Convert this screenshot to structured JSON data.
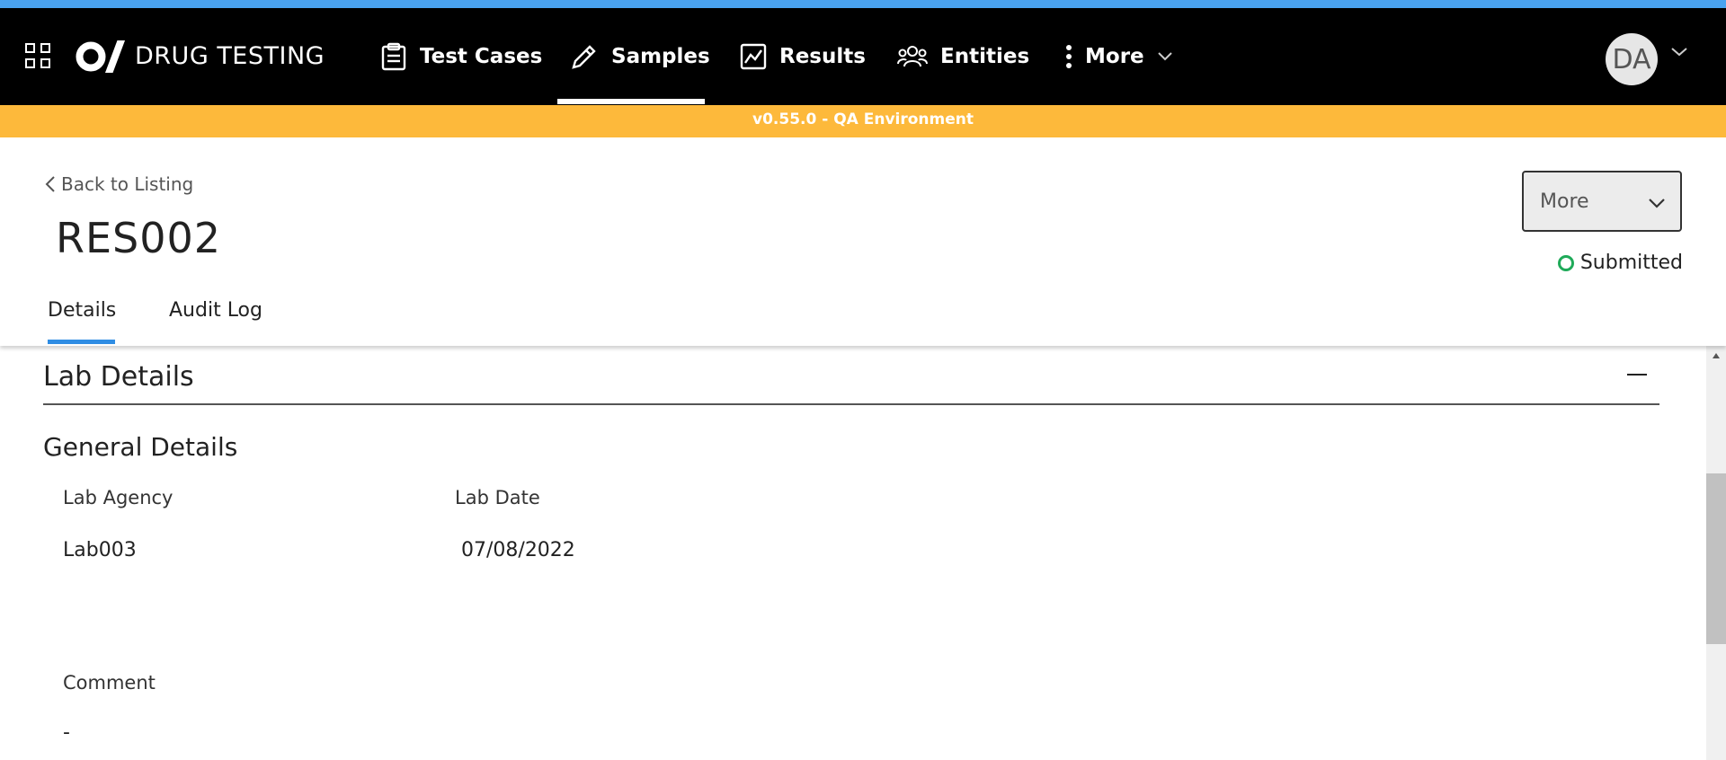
{
  "app": {
    "brand": "DRUG TESTING"
  },
  "nav": {
    "items": [
      {
        "label": "Test Cases",
        "icon": "clipboard-icon"
      },
      {
        "label": "Samples",
        "icon": "pen-icon",
        "active": true
      },
      {
        "label": "Results",
        "icon": "chart-icon"
      },
      {
        "label": "Entities",
        "icon": "people-icon"
      },
      {
        "label": "More",
        "icon": "kebab-icon"
      }
    ]
  },
  "user": {
    "initials": "DA"
  },
  "env": {
    "banner": "v0.55.0 - QA Environment"
  },
  "header": {
    "back_label": "Back to Listing",
    "title": "RES002",
    "tabs": [
      {
        "label": "Details",
        "active": true
      },
      {
        "label": "Audit Log"
      }
    ],
    "more_label": "More",
    "status": "Submitted"
  },
  "section": {
    "title": "Lab Details",
    "subtitle": "General Details",
    "fields": [
      {
        "label": "Lab Agency",
        "value": "Lab003"
      },
      {
        "label": "Lab Date",
        "value": "07/08/2022"
      },
      {
        "label": "Comment",
        "value": "-"
      }
    ]
  },
  "colors": {
    "accent": "#2f8de4",
    "env_banner": "#fdb93b",
    "status_submitted": "#1faa59",
    "top_strip": "#4aa3f0"
  }
}
